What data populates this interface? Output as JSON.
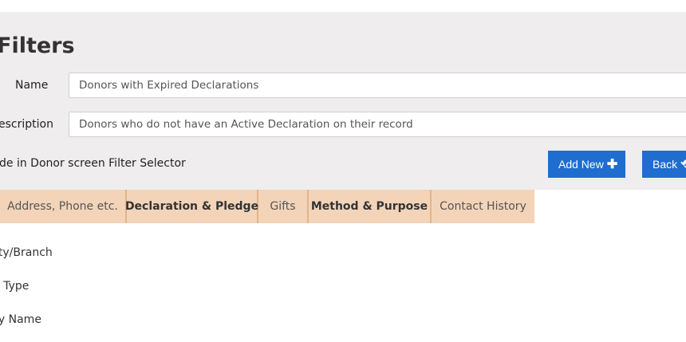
{
  "page": {
    "title": "Filters"
  },
  "form": {
    "name_label": "Name",
    "name_value": "Donors with Expired Declarations",
    "description_label": "escription",
    "description_value": "Donors who do not have an Active Declaration on their record",
    "include_label": "de in Donor screen Filter Selector"
  },
  "buttons": {
    "add_new": "Add New",
    "back": "Back"
  },
  "tabs": [
    {
      "label": "Address, Phone etc."
    },
    {
      "label": "Declaration & Pledge"
    },
    {
      "label": "Gifts"
    },
    {
      "label": "Method & Purpose"
    },
    {
      "label": "Contact History"
    }
  ],
  "fields": [
    {
      "label": "ity/Branch"
    },
    {
      "label": "r Type"
    },
    {
      "label": "ly Name"
    }
  ],
  "colors": {
    "accent": "#1f6dce",
    "tab_bg": "#f3d4b8",
    "panel_bg": "#efeded"
  }
}
